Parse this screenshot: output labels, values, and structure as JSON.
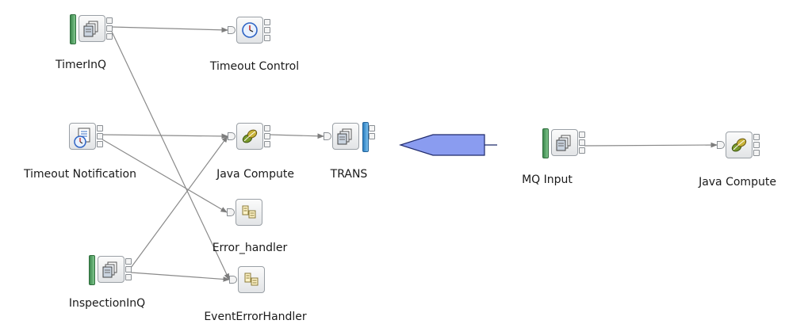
{
  "nodes": [
    {
      "id": "timerinq",
      "label": "TimerInQ",
      "kind": "mq-input",
      "icon": "queue-input-icon"
    },
    {
      "id": "timeout-control",
      "label": "Timeout Control",
      "kind": "timeout-control",
      "icon": "clock-icon"
    },
    {
      "id": "timeout-notification",
      "label": "Timeout Notification",
      "kind": "timeout-notification",
      "icon": "clock-document-icon"
    },
    {
      "id": "java-compute-1",
      "label": "Java Compute",
      "kind": "java-compute",
      "icon": "java-bean-icon"
    },
    {
      "id": "trans",
      "label": "TRANS",
      "kind": "mq-output",
      "icon": "queue-output-icon"
    },
    {
      "id": "error-handler",
      "label": "Error_handler",
      "kind": "subflow",
      "icon": "subflow-icon"
    },
    {
      "id": "inspectioninq",
      "label": "InspectionInQ",
      "kind": "mq-input",
      "icon": "queue-input-icon"
    },
    {
      "id": "event-error-handler",
      "label": "EventErrorHandler",
      "kind": "subflow",
      "icon": "subflow-icon"
    },
    {
      "id": "mq-input",
      "label": "MQ Input",
      "kind": "mq-input",
      "icon": "queue-input-icon"
    },
    {
      "id": "java-compute-2",
      "label": "Java Compute",
      "kind": "java-compute",
      "icon": "java-bean-icon"
    }
  ],
  "connections": [
    {
      "from": "timerinq",
      "to": "timeout-control"
    },
    {
      "from": "timerinq",
      "to": "event-error-handler"
    },
    {
      "from": "timeout-notification",
      "to": "java-compute-1"
    },
    {
      "from": "timeout-notification",
      "to": "error-handler"
    },
    {
      "from": "inspectioninq",
      "to": "java-compute-1"
    },
    {
      "from": "inspectioninq",
      "to": "event-error-handler"
    },
    {
      "from": "java-compute-1",
      "to": "trans"
    },
    {
      "from": "mq-input",
      "to": "java-compute-2"
    }
  ],
  "transform_arrow": {
    "direction": "left",
    "fill": "#8a9cf0",
    "stroke": "#1f2a6b"
  },
  "colors": {
    "input_bar": "#4fa862",
    "output_bar": "#3f98d8",
    "wire": "#8a8a8a"
  }
}
